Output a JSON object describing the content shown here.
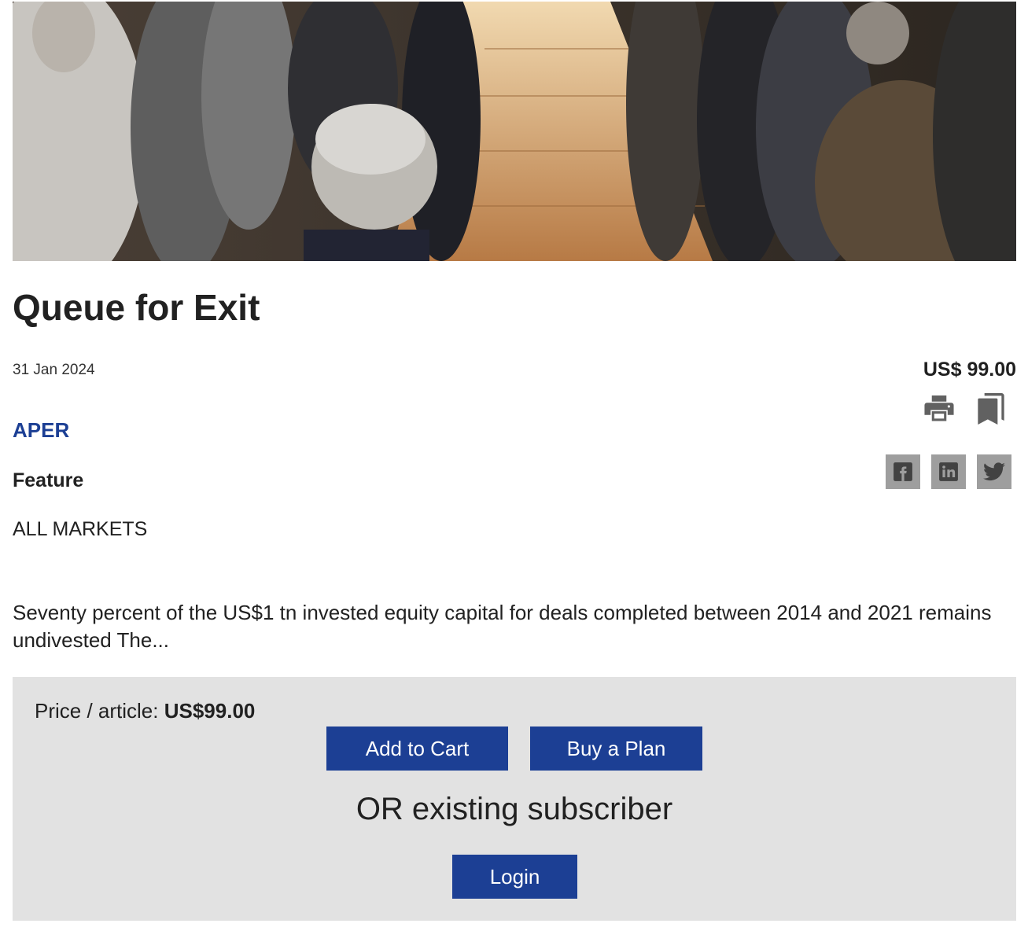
{
  "article": {
    "title": "Queue for Exit",
    "date": "31 Jan 2024",
    "price": "US$ 99.00",
    "source": "APER",
    "type": "Feature",
    "market": "ALL MARKETS",
    "excerpt": "Seventy percent of the US$1 tn invested equity capital for deals completed between 2014 and 2021 remains undivested The..."
  },
  "tools": {
    "icons": [
      "print-icon",
      "bookmark-icon"
    ]
  },
  "share": {
    "icons": [
      "facebook-icon",
      "linkedin-icon",
      "twitter-icon"
    ]
  },
  "paywall": {
    "price_label": "Price / article: ",
    "price_value": "US$99.00",
    "add_to_cart": "Add to Cart",
    "buy_plan": "Buy a Plan",
    "or_text": "OR existing subscriber",
    "login": "Login"
  },
  "colors": {
    "accent": "#1c3f94",
    "paywall_bg": "#e2e2e2",
    "share_bg": "#9e9e9e"
  }
}
